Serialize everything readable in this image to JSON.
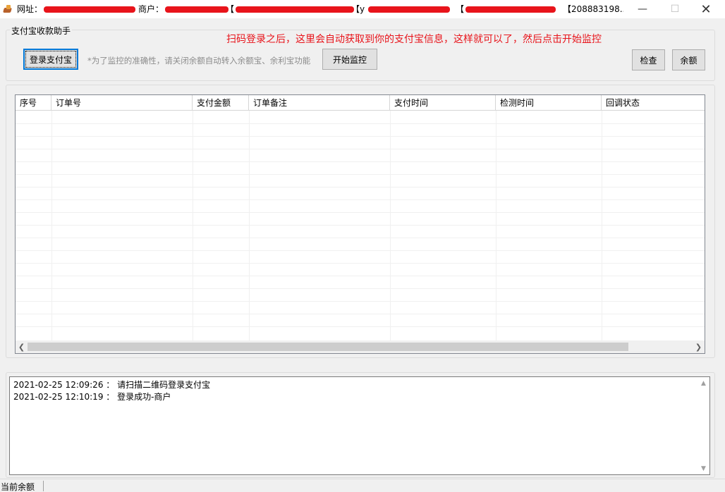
{
  "window": {
    "title_parts": {
      "site_label": "网址：",
      "merchant_label": "商户：",
      "bracket_company": "【",
      "bracket_user": "【y",
      "bracket_email": "【",
      "partner_id": "【208883198..."
    }
  },
  "group": {
    "title": "支付宝收款助手",
    "login_label": "登录支付宝",
    "hint": "*为了监控的准确性，请关闭余额自动转入余额宝、余利宝功能",
    "monitor_label": "开始监控",
    "check_label": "检查",
    "balance_label": "余额"
  },
  "annotation": "扫码登录之后，这里会自动获取到你的支付宝信息，这样就可以了，然后点击开始监控",
  "table": {
    "columns": [
      "序号",
      "订单号",
      "支付金额",
      "订单备注",
      "支付时间",
      "检测时间",
      "回调状态"
    ],
    "rows": []
  },
  "log": {
    "lines": [
      "2021-02-25 12:09:26 ： 请扫描二维码登录支付宝",
      "2021-02-25 12:10:19 ： 登录成功-商户"
    ]
  },
  "status": {
    "label": "当前余额"
  }
}
